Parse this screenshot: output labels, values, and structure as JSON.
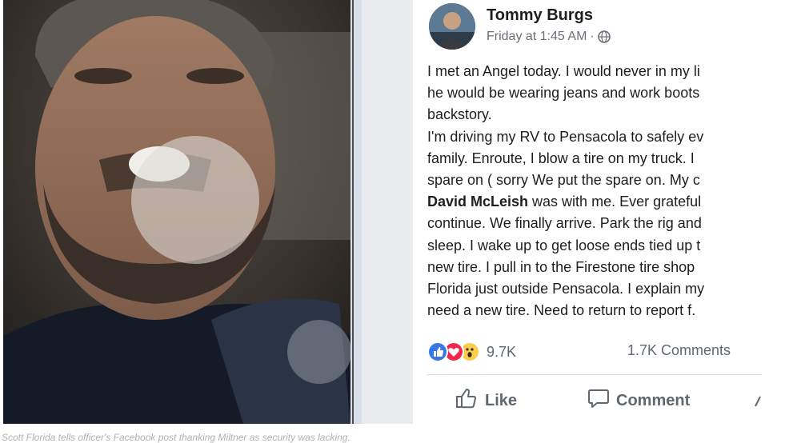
{
  "post": {
    "author": "Tommy Burgs",
    "timestamp": "Friday at 1:45 AM",
    "separator": "·",
    "visibility_icon": "globe-icon",
    "lines": [
      "I met an Angel today. I would never in my li",
      "he would be wearing jeans and work boots",
      "backstory.",
      "I'm driving my RV to Pensacola to safely ev",
      "family. Enroute, I blow a tire on my truck. I",
      "spare on ( sorry We put the spare on. My c",
      {
        "bold": "David McLeish",
        "rest": " was with me. Ever grateful"
      },
      "continue. We finally arrive. Park the rig and",
      "sleep. I wake up to get loose ends tied up t",
      "new tire. I pull in to the Firestone tire shop",
      "Florida just outside Pensacola. I explain my",
      "need a new tire. Need to return to report f."
    ],
    "reaction_count": "9.7K",
    "comment_count": "1.7K Comments",
    "actions": {
      "like_label": "Like",
      "comment_label": "Comment"
    }
  },
  "colors": {
    "like_blue": "#3578e5",
    "love_red": "#f0284a",
    "wow_yellow": "#fbcd4d",
    "text_gray": "#606770"
  },
  "caption": "Scott Florida tells officer's Facebook post thanking Miltner as security was lacking."
}
